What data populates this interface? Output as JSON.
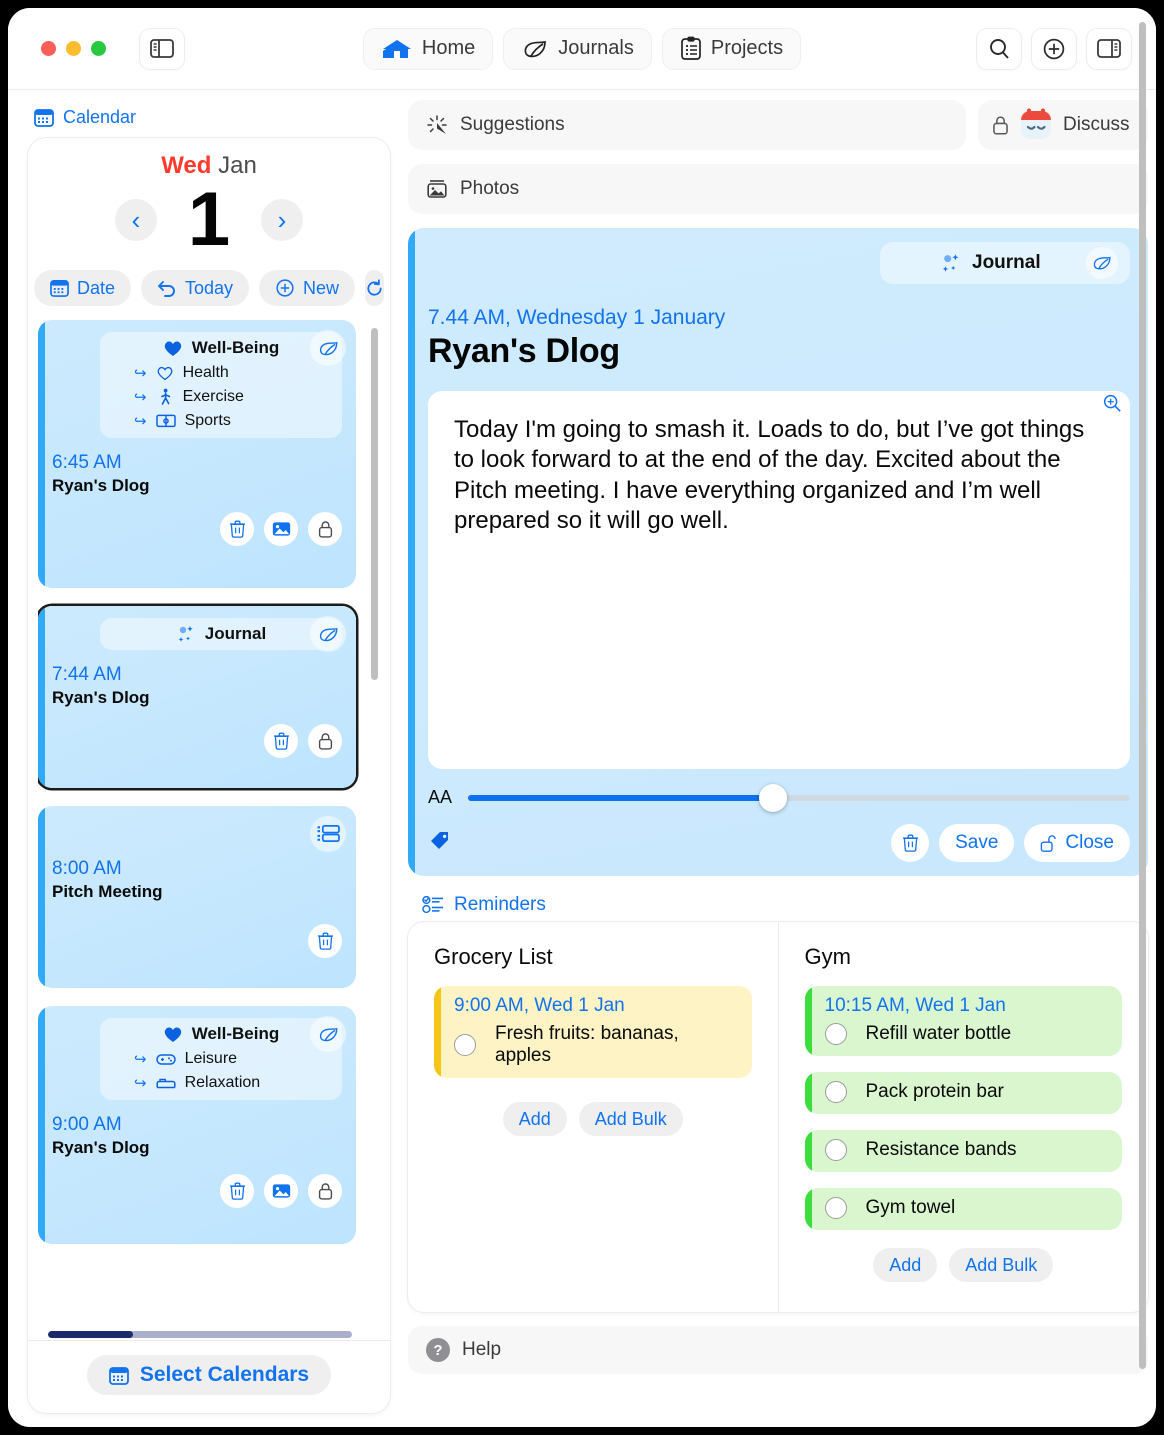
{
  "titlebar": {
    "sidebar_toggle_icon": "sidebar-left-icon",
    "tabs": [
      {
        "label": "Home",
        "icon": "home-icon",
        "active": true
      },
      {
        "label": "Journals",
        "icon": "leaf-icon",
        "active": false
      },
      {
        "label": "Projects",
        "icon": "clipboard-icon",
        "active": false
      }
    ],
    "right_buttons": [
      {
        "name": "search-button",
        "icon": "search-icon"
      },
      {
        "name": "add-button",
        "icon": "plus-circle-icon"
      },
      {
        "name": "inspector-toggle-button",
        "icon": "sidebar-right-icon"
      }
    ]
  },
  "sidebar": {
    "header": {
      "label": "Calendar",
      "icon": "calendar-icon"
    },
    "date": {
      "weekday": "Wed",
      "month": "Jan",
      "day": "1"
    },
    "nav": {
      "prev": "‹",
      "next": "›"
    },
    "controls": [
      {
        "label": "Date",
        "icon": "calendar-icon",
        "name": "date-button"
      },
      {
        "label": "Today",
        "icon": "undo-icon",
        "name": "today-button"
      },
      {
        "label": "New",
        "icon": "plus-circle-icon",
        "name": "new-button"
      },
      {
        "label": "",
        "icon": "refresh-icon",
        "name": "refresh-button"
      }
    ],
    "events": [
      {
        "category": "Well-Being",
        "category_icon": "heart-filled-icon",
        "badge_icon": "leaf-icon",
        "subs": [
          {
            "label": "Health",
            "icon": "heart-outline-icon"
          },
          {
            "label": "Exercise",
            "icon": "walking-person-icon"
          },
          {
            "label": "Sports",
            "icon": "sports-field-icon"
          }
        ],
        "time": "6:45 AM",
        "title": "Ryan's Dlog",
        "actions": [
          "trash-icon",
          "photo-icon",
          "lock-icon"
        ],
        "selected": false
      },
      {
        "category": "Journal",
        "category_icon": "sparkles-icon",
        "badge_icon": "leaf-icon",
        "subs": [],
        "time": "7:44 AM",
        "title": "Ryan's Dlog",
        "actions": [
          "trash-icon",
          "lock-icon"
        ],
        "selected": true
      },
      {
        "category": "",
        "category_icon": "",
        "badge_icon": "list-card-icon",
        "subs": [],
        "time": "8:00 AM",
        "title": "Pitch Meeting",
        "actions": [
          "trash-icon"
        ],
        "selected": false
      },
      {
        "category": "Well-Being",
        "category_icon": "heart-filled-icon",
        "badge_icon": "leaf-icon",
        "subs": [
          {
            "label": "Leisure",
            "icon": "gamepad-icon"
          },
          {
            "label": "Relaxation",
            "icon": "bed-icon"
          }
        ],
        "time": "9:00 AM",
        "title": "Ryan's Dlog",
        "actions": [
          "trash-icon",
          "photo-icon",
          "lock-icon"
        ],
        "selected": false
      }
    ],
    "footer": {
      "label": "Select Calendars",
      "icon": "calendar-icon"
    }
  },
  "main": {
    "suggestions": {
      "label": "Suggestions",
      "icon": "sparkle-burst-icon"
    },
    "discuss": {
      "label": "Discuss",
      "lock_icon": "lock-icon",
      "avatar": "calendar-face-avatar"
    },
    "photos": {
      "label": "Photos",
      "icon": "photo-stack-icon"
    },
    "journal": {
      "tag_label": "Journal",
      "tag_icon": "sparkles-icon",
      "leaf_icon": "leaf-icon",
      "zoom_icon": "zoom-in-icon",
      "date": "7.44 AM, Wednesday 1 January",
      "title": "Ryan's Dlog",
      "body": "Today I'm going to smash it. Loads to do, but I’ve got things to look forward to at the end of the day. Excited about the Pitch meeting. I have everything organized and I’m well prepared so it will go well.",
      "font_slider": {
        "label": "AA",
        "value_percent": 46
      },
      "tag_button_icon": "tag-icon",
      "actions": [
        {
          "label": "",
          "icon": "trash-icon",
          "name": "delete-journal-button"
        },
        {
          "label": "Save",
          "icon": "",
          "name": "save-button"
        },
        {
          "label": "Close",
          "icon": "unlock-icon",
          "name": "close-button"
        }
      ]
    },
    "reminders": {
      "header": {
        "label": "Reminders",
        "icon": "checklist-icon"
      },
      "lists": [
        {
          "title": "Grocery List",
          "color": "yellow",
          "items": [
            {
              "time": "9:00 AM, Wed 1 Jan",
              "text": "Fresh fruits: bananas, apples",
              "checked": false
            }
          ],
          "buttons": [
            "Add",
            "Add Bulk"
          ]
        },
        {
          "title": "Gym",
          "color": "green",
          "items": [
            {
              "time": "10:15 AM, Wed 1 Jan",
              "text": "Refill water bottle",
              "checked": false
            },
            {
              "time": "",
              "text": "Pack protein bar",
              "checked": false
            },
            {
              "time": "",
              "text": "Resistance bands",
              "checked": false
            },
            {
              "time": "",
              "text": "Gym towel",
              "checked": false
            }
          ],
          "buttons": [
            "Add",
            "Add Bulk"
          ]
        }
      ]
    },
    "help": {
      "label": "Help",
      "icon": "question-mark-icon"
    }
  },
  "colors": {
    "accent_blue": "#1273ef",
    "red": "#ff3b30",
    "card_blue": "#cdeafd",
    "stripe_blue": "#30a9f6",
    "yellow": "#fdf3c4",
    "green": "#d9f6cf"
  }
}
